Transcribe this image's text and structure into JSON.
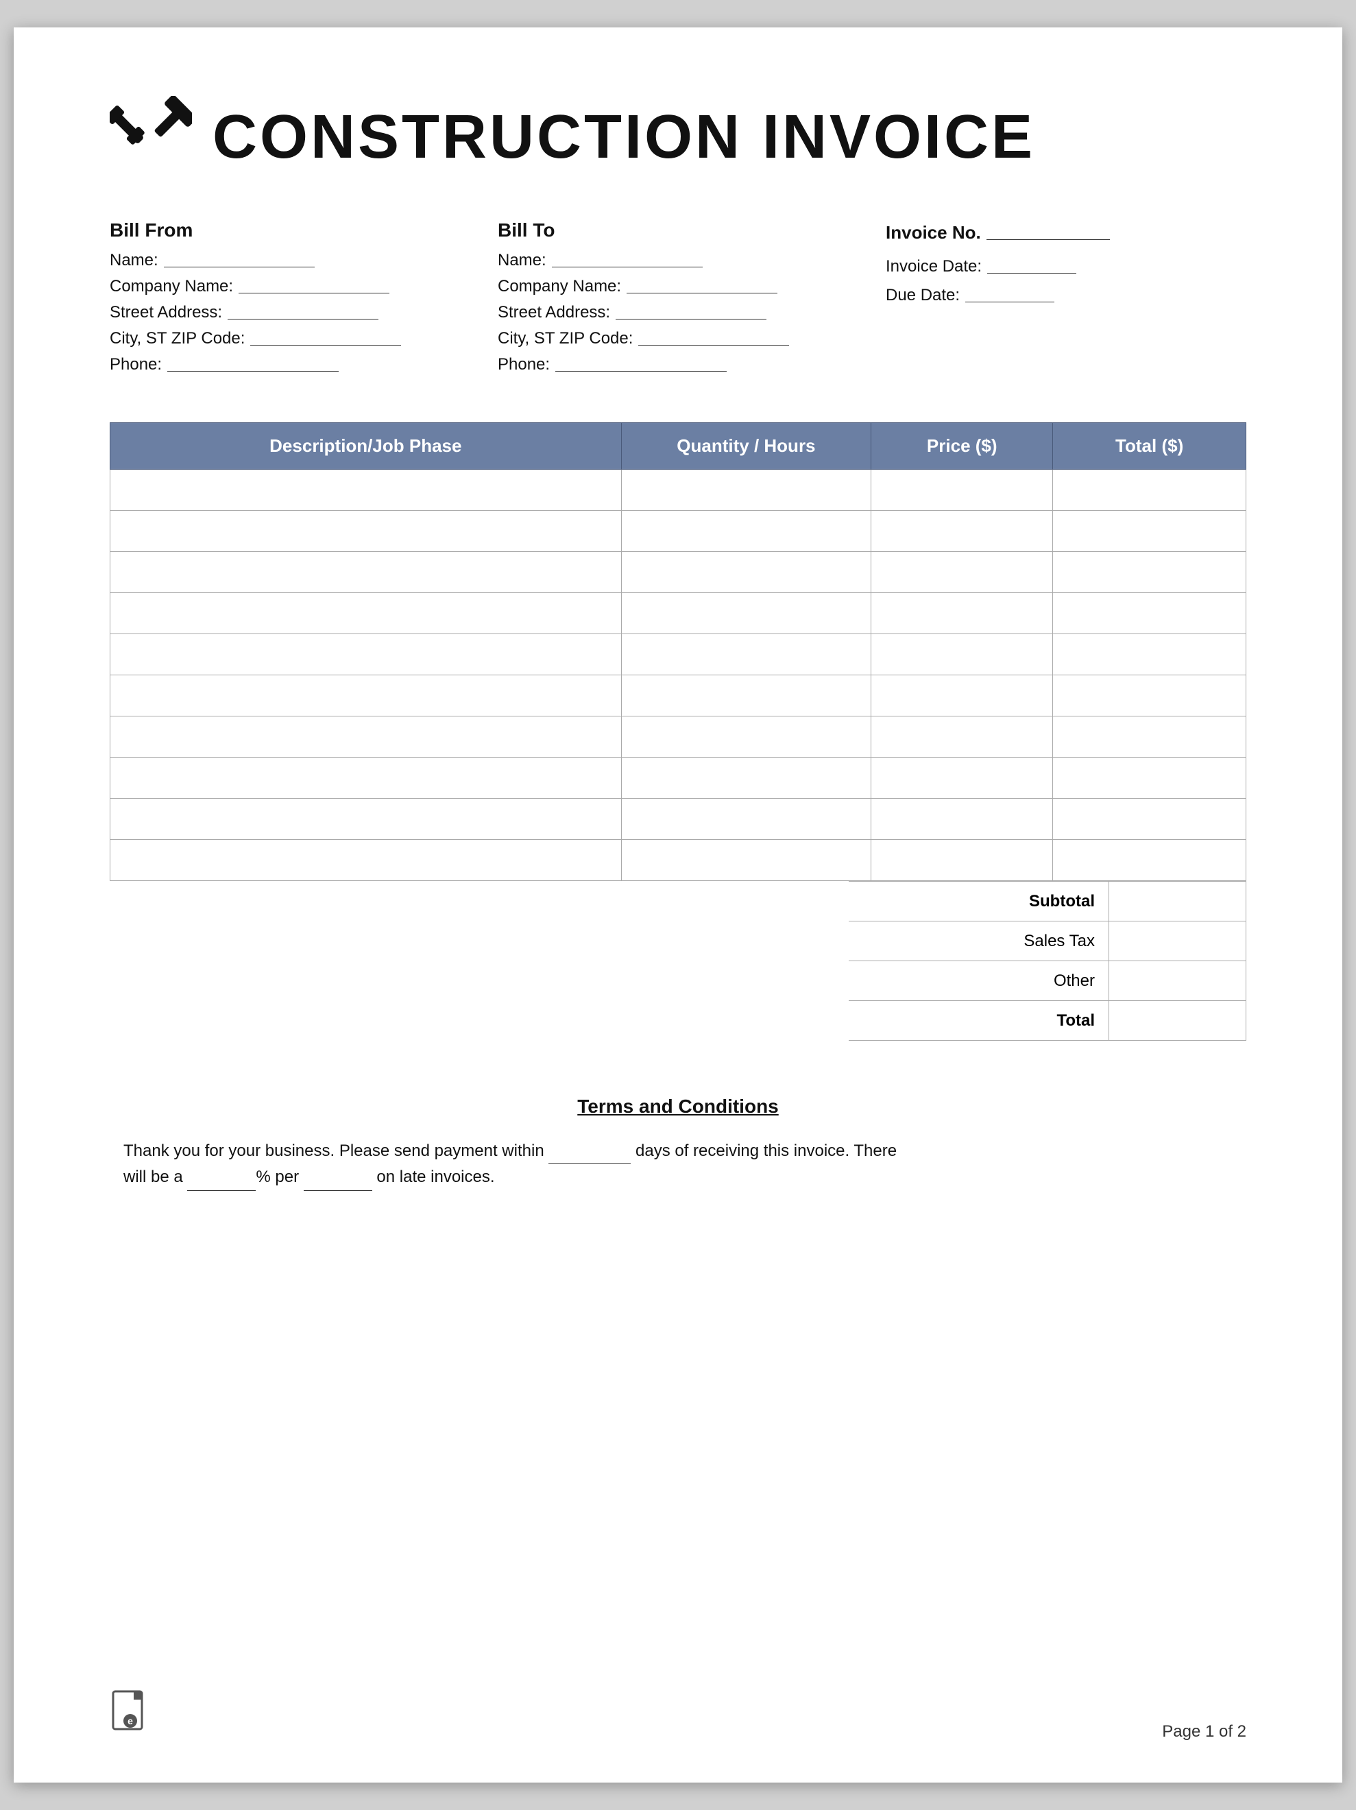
{
  "header": {
    "title": "CONSTRUCTION INVOICE",
    "icon_alt": "tools-wrench-hammer-icon"
  },
  "bill_from": {
    "label": "Bill From",
    "fields": [
      {
        "label": "Name:",
        "value": ""
      },
      {
        "label": "Company Name:",
        "value": ""
      },
      {
        "label": "Street Address:",
        "value": ""
      },
      {
        "label": "City, ST ZIP Code:",
        "value": ""
      },
      {
        "label": "Phone:",
        "value": ""
      }
    ]
  },
  "bill_to": {
    "label": "Bill To",
    "fields": [
      {
        "label": "Name:",
        "value": ""
      },
      {
        "label": "Company Name:",
        "value": ""
      },
      {
        "label": "Street Address:",
        "value": ""
      },
      {
        "label": "City, ST ZIP Code:",
        "value": ""
      },
      {
        "label": "Phone:",
        "value": ""
      }
    ]
  },
  "invoice_info": {
    "invoice_no_label": "Invoice No.",
    "invoice_date_label": "Invoice Date:",
    "due_date_label": "Due Date:"
  },
  "table": {
    "headers": [
      "Description/Job Phase",
      "Quantity / Hours",
      "Price ($)",
      "Total ($)"
    ],
    "rows": 10
  },
  "summary": {
    "subtotal_label": "Subtotal",
    "sales_tax_label": "Sales Tax",
    "other_label": "Other",
    "total_label": "Total"
  },
  "terms": {
    "title": "Terms and Conditions",
    "text_part1": "Thank you for your business. Please send payment within",
    "text_part2": "days of receiving this invoice. There will be a",
    "text_part3": "% per",
    "text_part4": "on late invoices."
  },
  "footer": {
    "page_text": "Page 1 of 2",
    "icon_alt": "document-icon"
  }
}
